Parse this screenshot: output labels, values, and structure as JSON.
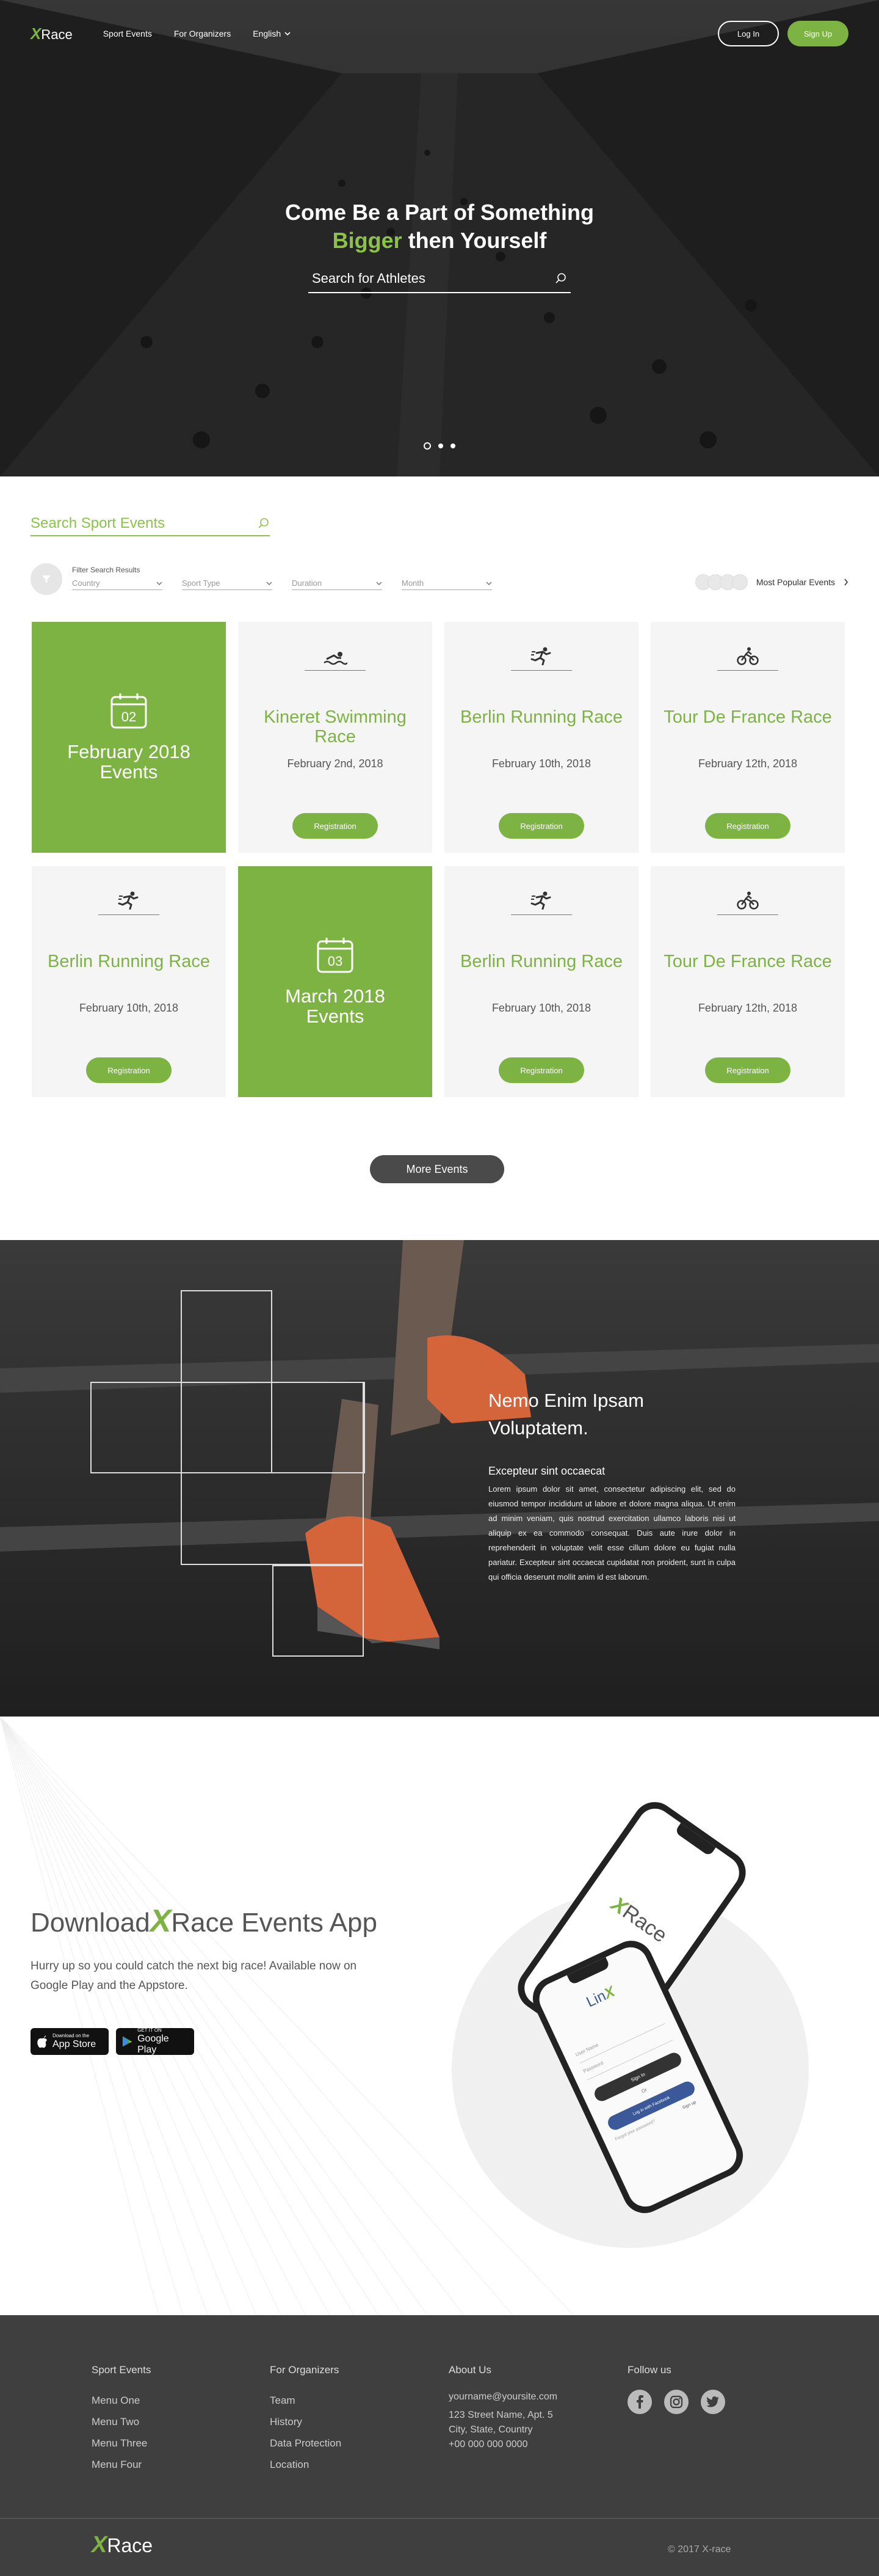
{
  "brand": {
    "logo_mark": "X",
    "logo_text": "Race",
    "accent": "#7cb342"
  },
  "nav": {
    "links": [
      "Sport Events",
      "For Organizers",
      "English"
    ],
    "login": "Log In",
    "signup": "Sign Up"
  },
  "hero": {
    "line1": "Come Be a Part of Something",
    "line2_green": "Bigger",
    "line2_rest": " then Yourself",
    "search_placeholder": "Search for Athletes",
    "slide_count": 3,
    "active_slide": 1
  },
  "events": {
    "search_placeholder": "Search Sport Events",
    "filter_label": "Filter Search Results",
    "filters": [
      "Country",
      "Sport Type",
      "Duration",
      "Month"
    ],
    "popular_label": "Most Popular Events",
    "registration_label": "Registration",
    "cards": [
      {
        "type": "month",
        "number": "02",
        "month": "February 2018",
        "sub": "Events"
      },
      {
        "type": "event",
        "icon": "swimming-icon",
        "title": "Kineret Swimming Race",
        "date": "February 2nd, 2018"
      },
      {
        "type": "event",
        "icon": "running-icon",
        "title": "Berlin Running Race",
        "date": "February 10th, 2018"
      },
      {
        "type": "event",
        "icon": "cycling-icon",
        "title": "Tour De France Race",
        "date": "February 12th, 2018"
      },
      {
        "type": "event",
        "icon": "running-icon",
        "title": "Berlin Running Race",
        "date": "February 10th, 2018"
      },
      {
        "type": "month",
        "number": "03",
        "month": "March 2018",
        "sub": "Events"
      },
      {
        "type": "event",
        "icon": "running-icon",
        "title": "Berlin Running Race",
        "date": "February 10th, 2018"
      },
      {
        "type": "event",
        "icon": "cycling-icon",
        "title": "Tour De France Race",
        "date": "February 12th, 2018"
      }
    ],
    "more_label": "More Events"
  },
  "feature": {
    "title_line1": "Nemo Enim Ipsam",
    "title_line2": "Voluptatem.",
    "subtitle": "Excepteur sint occaecat",
    "body": "Lorem ipsum dolor sit amet, consectetur adipiscing elit, sed do eiusmod tempor incididunt ut labore et dolore magna aliqua. Ut enim ad minim veniam, quis nostrud exercitation ullamco laboris nisi ut aliquip ex ea commodo consequat. Duis aute irure dolor in reprehenderit in voluptate velit esse cillum dolore eu fugiat nulla pariatur. Excepteur sint occaecat cupidatat non proident, sunt in culpa qui officia deserunt mollit anim id est laborum."
  },
  "app": {
    "title_prefix": "Download",
    "title_mark": "X",
    "title_race": "Race",
    "title_suffix": " Events App",
    "description": "Hurry up so you could catch the next big race! Available now on Google Play and the Appstore.",
    "appstore_small": "Download on the",
    "appstore_big": "App Store",
    "googleplay_small": "GET IT ON",
    "googleplay_big": "Google Play",
    "phone_back": {
      "logo_mark": "X",
      "logo_text": "Race"
    },
    "phone_front": {
      "logo_text": "Lin",
      "logo_mark": "X",
      "field1": "User Name",
      "field2": "Password",
      "signin": "Sign In",
      "or": "Or",
      "facebook": "Log in with Facebook",
      "forgot": "Forgot your password?",
      "signup": "Sign up"
    }
  },
  "footer": {
    "col1": {
      "heading": "Sport Events",
      "items": [
        "Menu One",
        "Menu Two",
        "Menu Three",
        "Menu Four"
      ]
    },
    "col2": {
      "heading": "For Organizers",
      "items": [
        "Team",
        "History",
        "Data Protection",
        "Location"
      ]
    },
    "col3": {
      "heading": "About Us",
      "email": "yourname@yoursite.com",
      "address1": "123 Street Name, Apt. 5",
      "address2": "City, State, Country",
      "phone": "+00 000 000 0000"
    },
    "col4": {
      "heading": "Follow us",
      "icons": [
        "facebook-icon",
        "instagram-icon",
        "twitter-icon"
      ]
    },
    "logo_mark": "X",
    "logo_text": "Race",
    "copyright": "© 2017 X-race"
  }
}
